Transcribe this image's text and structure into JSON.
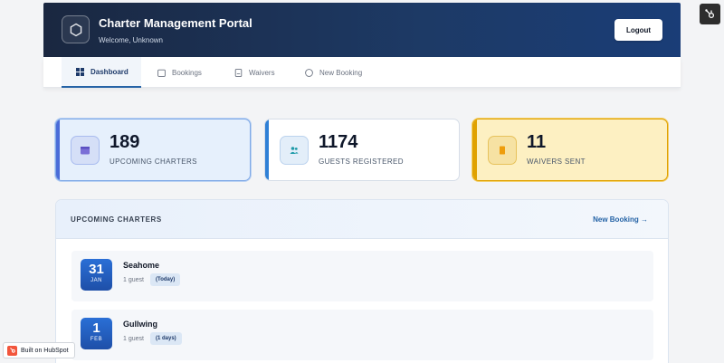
{
  "header": {
    "title": "Charter Management Portal",
    "welcome": "Welcome, Unknown",
    "logout_label": "Logout",
    "logo_icon": "hexagon-icon"
  },
  "tabs": [
    {
      "label": "Dashboard",
      "icon": "grid-icon",
      "active": true
    },
    {
      "label": "Bookings",
      "icon": "calendar-icon",
      "active": false
    },
    {
      "label": "Waivers",
      "icon": "document-icon",
      "active": false
    },
    {
      "label": "New Booking",
      "icon": "plus-circle-icon",
      "active": false
    }
  ],
  "stats": [
    {
      "value": "189",
      "label": "UPCOMING CHARTERS",
      "icon": "calendar-icon",
      "accent": "#4a6cd8"
    },
    {
      "value": "1174",
      "label": "GUESTS REGISTERED",
      "icon": "users-icon",
      "accent": "#2f80d6"
    },
    {
      "value": "11",
      "label": "WAIVERS SENT",
      "icon": "waiver-icon",
      "accent": "#e0a100"
    }
  ],
  "upcoming": {
    "title": "UPCOMING CHARTERS",
    "new_booking_link": "New Booking →",
    "items": [
      {
        "day": "31",
        "month": "JAN",
        "name": "Seahome",
        "guests": "1 guest",
        "badge": "(Today)"
      },
      {
        "day": "1",
        "month": "FEB",
        "name": "Gullwing",
        "guests": "1 guest",
        "badge": "(1 days)"
      }
    ]
  },
  "hubspot": {
    "built_label": "Built on HubSpot",
    "corner_icon": "hubspot-sprocket-icon"
  },
  "colors": {
    "header_dark": "#1a2740",
    "primary_blue": "#2563a6",
    "charters_card_bg": "#e6f0fc",
    "guests_card_bg": "#ffffff",
    "waivers_card_bg": "#fdf0c2",
    "hubspot_orange": "#f2553c"
  }
}
